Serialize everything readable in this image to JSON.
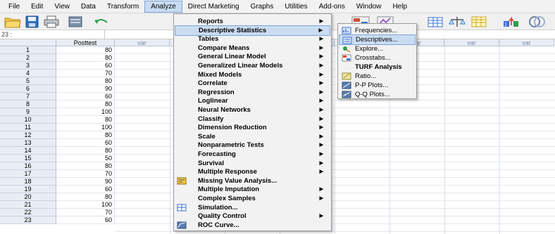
{
  "menubar": {
    "items": [
      "File",
      "Edit",
      "View",
      "Data",
      "Transform",
      "Analyze",
      "Direct Marketing",
      "Graphs",
      "Utilities",
      "Add-ons",
      "Window",
      "Help"
    ],
    "active": "Analyze"
  },
  "cell_editor": {
    "cell_ref": "23 :"
  },
  "grid": {
    "columns": [
      "Posttest",
      "var",
      "var",
      "var",
      "var",
      "var",
      "var",
      "var",
      "var",
      "var"
    ],
    "rows": [
      {
        "n": "1",
        "posttest": "80"
      },
      {
        "n": "2",
        "posttest": "80"
      },
      {
        "n": "3",
        "posttest": "60"
      },
      {
        "n": "4",
        "posttest": "70"
      },
      {
        "n": "5",
        "posttest": "80"
      },
      {
        "n": "6",
        "posttest": "90"
      },
      {
        "n": "7",
        "posttest": "60"
      },
      {
        "n": "8",
        "posttest": "80"
      },
      {
        "n": "9",
        "posttest": "100"
      },
      {
        "n": "10",
        "posttest": "80"
      },
      {
        "n": "11",
        "posttest": "100"
      },
      {
        "n": "12",
        "posttest": "80"
      },
      {
        "n": "13",
        "posttest": "60"
      },
      {
        "n": "14",
        "posttest": "80"
      },
      {
        "n": "15",
        "posttest": "50"
      },
      {
        "n": "16",
        "posttest": "80"
      },
      {
        "n": "17",
        "posttest": "70"
      },
      {
        "n": "18",
        "posttest": "90"
      },
      {
        "n": "19",
        "posttest": "60"
      },
      {
        "n": "20",
        "posttest": "80"
      },
      {
        "n": "21",
        "posttest": "100"
      },
      {
        "n": "22",
        "posttest": "70"
      },
      {
        "n": "23",
        "posttest": "60"
      }
    ]
  },
  "analyze_menu": {
    "items": [
      {
        "label": "Reports",
        "submenu": true
      },
      {
        "label": "Descriptive Statistics",
        "submenu": true,
        "highlighted": true
      },
      {
        "label": "Tables",
        "submenu": true
      },
      {
        "label": "Compare Means",
        "submenu": true
      },
      {
        "label": "General Linear Model",
        "submenu": true
      },
      {
        "label": "Generalized Linear Models",
        "submenu": true
      },
      {
        "label": "Mixed Models",
        "submenu": true
      },
      {
        "label": "Correlate",
        "submenu": true
      },
      {
        "label": "Regression",
        "submenu": true
      },
      {
        "label": "Loglinear",
        "submenu": true
      },
      {
        "label": "Neural Networks",
        "submenu": true
      },
      {
        "label": "Classify",
        "submenu": true
      },
      {
        "label": "Dimension Reduction",
        "submenu": true
      },
      {
        "label": "Scale",
        "submenu": true
      },
      {
        "label": "Nonparametric Tests",
        "submenu": true
      },
      {
        "label": "Forecasting",
        "submenu": true
      },
      {
        "label": "Survival",
        "submenu": true
      },
      {
        "label": "Multiple Response",
        "submenu": true
      },
      {
        "label": "Missing Value Analysis...",
        "submenu": false,
        "icon": "missing-values-icon"
      },
      {
        "label": "Multiple Imputation",
        "submenu": true
      },
      {
        "label": "Complex Samples",
        "submenu": true
      },
      {
        "label": "Simulation...",
        "submenu": false,
        "icon": "simulation-icon"
      },
      {
        "label": "Quality Control",
        "submenu": true
      },
      {
        "label": "ROC Curve...",
        "submenu": false,
        "icon": "roc-curve-icon"
      }
    ]
  },
  "descriptive_submenu": {
    "items": [
      {
        "label": "Frequencies...",
        "icon": "frequencies-icon"
      },
      {
        "label": "Descriptives...",
        "icon": "descriptives-icon",
        "highlighted": true
      },
      {
        "label": "Explore...",
        "icon": "explore-icon"
      },
      {
        "label": "Crosstabs...",
        "icon": "crosstabs-icon"
      },
      {
        "label": "TURF Analysis",
        "icon": ""
      },
      {
        "label": "Ratio...",
        "icon": "ratio-icon"
      },
      {
        "label": "P-P Plots...",
        "icon": "pp-plots-icon"
      },
      {
        "label": "Q-Q Plots...",
        "icon": "qq-plots-icon"
      }
    ]
  },
  "colors": {
    "menu_highlight": "#c9dcf2",
    "menu_highlight_border": "#7ea6d6",
    "grid_header": "#e8edf5"
  }
}
